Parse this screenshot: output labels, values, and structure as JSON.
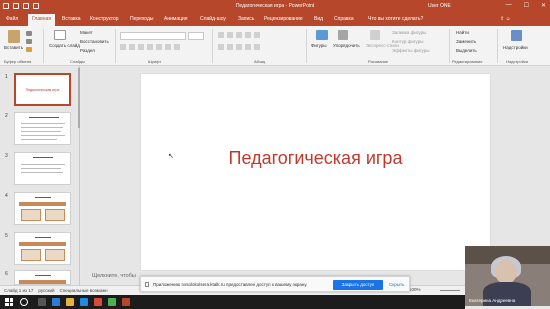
{
  "titlebar": {
    "title": "Педагогическая игра - PowerPoint",
    "user": "User ONE",
    "controls": [
      "—",
      "☐",
      "✕"
    ]
  },
  "tabs": [
    "Файл",
    "Главная",
    "Вставка",
    "Конструктор",
    "Переходы",
    "Анимация",
    "Слайд-шоу",
    "Запись",
    "Рецензирование",
    "Вид",
    "Справка"
  ],
  "tellme": "Что вы хотите сделать?",
  "ribbon": {
    "paste": "Вставить",
    "create_slide": "Создать слайд",
    "layout": "Макет",
    "reset": "Восстановить",
    "section": "Раздел",
    "shapes": "Фигуры",
    "arrange": "Упорядочить",
    "quick_styles": "Экспресс-стили",
    "shape_fill": "Заливка фигуры",
    "shape_outline": "Контур фигуры",
    "shape_effects": "Эффекты фигуры",
    "find": "Найти",
    "replace": "Заменить",
    "select": "Выделить",
    "addins": "Надстройки",
    "groups": {
      "clipboard": "Буфер обмена",
      "slides": "Слайды",
      "font": "Шрифт",
      "paragraph": "Абзац",
      "drawing": "Рисование",
      "editing": "Редактирование",
      "addins": "Надстройки"
    }
  },
  "thumbnails": [
    {
      "num": "1",
      "title": "Педагогическая игра"
    },
    {
      "num": "2"
    },
    {
      "num": "3"
    },
    {
      "num": "4"
    },
    {
      "num": "5"
    },
    {
      "num": "6"
    }
  ],
  "slide": {
    "title": "Педагогическая игра"
  },
  "notes_placeholder": "Щелкните, чтобы",
  "status": {
    "slide_info": "Слайд 1 из 17",
    "language": "русский",
    "accessibility": "Специальные возможн",
    "zoom": "100%"
  },
  "notification": {
    "text": "Приложению nvsolokolsera.ktalk.ru предоставлен доступ к вашему экрану.",
    "allow_button": "Закрыть доступ",
    "hide_button": "Скрыть"
  },
  "video": {
    "name": "Екатерина Андреевна"
  },
  "colors": {
    "accent": "#b7472a",
    "title_red": "#c0392b",
    "link_blue": "#1a73e8"
  }
}
